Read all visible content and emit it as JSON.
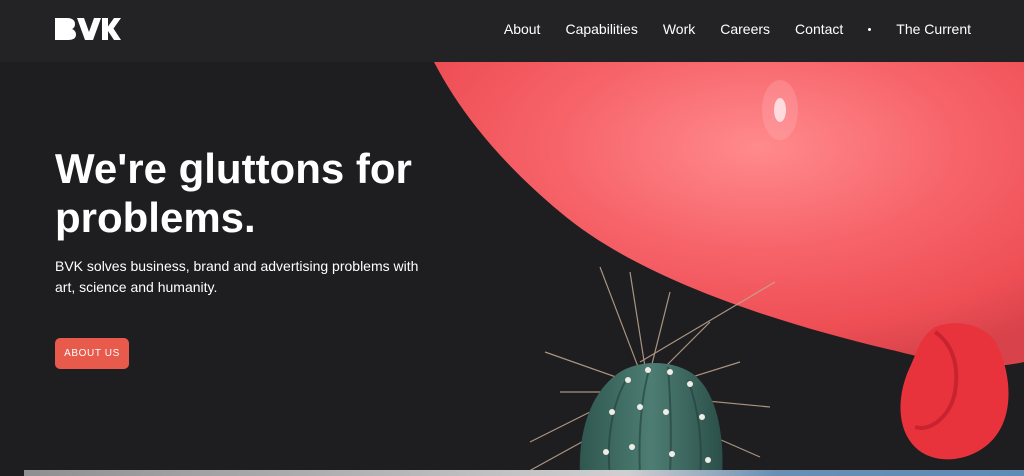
{
  "header": {
    "logo_text": "BVK",
    "nav": [
      {
        "label": "About"
      },
      {
        "label": "Capabilities"
      },
      {
        "label": "Work"
      },
      {
        "label": "Careers"
      },
      {
        "label": "Contact"
      },
      {
        "label": "The Current"
      }
    ]
  },
  "hero": {
    "headline": "We're gluttons for problems.",
    "subtext": "BVK solves business, brand and advertising problems with art, science and humanity.",
    "cta_label": "About Us"
  },
  "colors": {
    "background": "#1e1d1f",
    "header": "#232325",
    "accent": "#e85a4b",
    "balloon": "#f0555a",
    "cactus": "#3f6a62"
  },
  "icons": {
    "logo": "bvk-logo",
    "separator": "nav-dot-separator"
  }
}
